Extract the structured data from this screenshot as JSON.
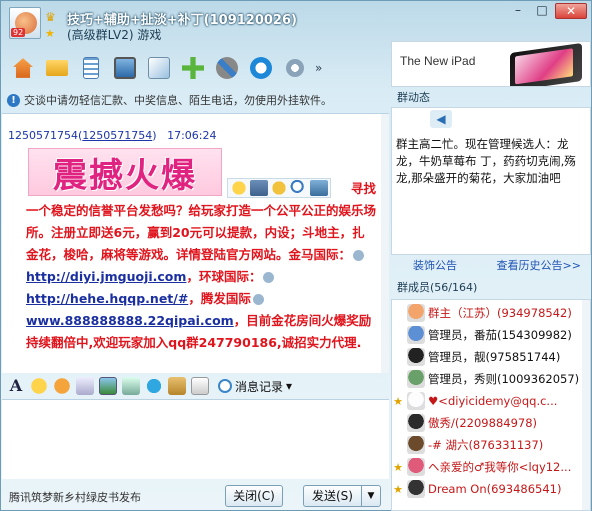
{
  "title": {
    "group_name": "技巧+辅助+扯淡+补丁(109120026)",
    "subtitle": "(高级群LV2) 游戏",
    "avatar_badge": "92"
  },
  "toolbar": {
    "icons": [
      "home-icon",
      "folder-icon",
      "document-icon",
      "screen-icon",
      "app-icon",
      "add-app-icon",
      "tools-icon",
      "refresh-icon",
      "settings-icon"
    ],
    "more_label": "»"
  },
  "notice": "交谈中请勿轻信汇款、中奖信息、陌生电话，勿使用外挂软件。",
  "chat": {
    "sender_name": "1250571754",
    "sender_link": "1250571754",
    "time": "17:06:24",
    "banner_text": "震撼火爆",
    "msg_line1_tail": "寻找",
    "msg_line2": "一个稳定的信誉平台发愁吗？给玩家打造一个公平公正的娱乐场所。注册立即送6元，赢到20元可以提款，内设；斗地主，扎金花，梭哈，麻将等游戏。详情登陆官方网站。金马国际：",
    "link1": "http://diyi.jmguoji.com",
    "mid1": "，环球国际：",
    "link2": "http://hehe.hqqp.net/#",
    "mid2": "，腾发国际",
    "link3": "www.888888888.22qipai.com",
    "msg_tail": "，目前金花房间火爆奖励持续翻倍中,欢迎玩家加入qq群247790186,诚招实力代理."
  },
  "input_toolbar": {
    "history_label": "消息记录"
  },
  "bottom": {
    "ad_text": "腾讯筑梦新乡村绿皮书发布",
    "close_label": "关闭(C)",
    "send_label": "发送(S)"
  },
  "right": {
    "ad_text": "The New iPad",
    "dynamics_title": "群动态",
    "dynamics_text": "群主高二忙。现在管理候选人：龙龙，牛奶草莓布 丁，药药切克闹,殇龙,那朵盛开的菊花，大家加油吧",
    "decor_notice": "装饰公告",
    "history_notice": "查看历史公告>>",
    "members_title": "群成员(56/164)",
    "members": [
      {
        "badge": "",
        "name": "群主（江苏）(934978542)",
        "style": "red",
        "avatar": "#f2a46b"
      },
      {
        "badge": "",
        "name": "管理员，番茄(154309982)",
        "style": "blk",
        "avatar": "#5d8fd4"
      },
      {
        "badge": "",
        "name": "管理员，靓(975851744)",
        "style": "blk",
        "avatar": "#222222"
      },
      {
        "badge": "",
        "name": "管理员，秀则(1009362057)",
        "style": "blk",
        "avatar": "#6aa06a"
      },
      {
        "badge": "★",
        "name": "♥<diyicidemy@qq.c...",
        "style": "red",
        "avatar": "#fdfdfd"
      },
      {
        "badge": "",
        "name": "傲秀/(2209884978)",
        "style": "red",
        "avatar": "#2b2b2b"
      },
      {
        "badge": "",
        "name": "-#  湖六(876331137)",
        "style": "red",
        "avatar": "#6b4b2b"
      },
      {
        "badge": "★",
        "name": "ヘ亲爱的♂我等你<lqy12...",
        "style": "red",
        "avatar": "#e05a7a"
      },
      {
        "badge": "★",
        "name": "Dream On(693486541)",
        "style": "red",
        "avatar": "#333333"
      }
    ]
  },
  "colors": {
    "accent_link": "#1d53b5",
    "spam_red": "#e0141c",
    "banner_pink": "#e02380"
  }
}
